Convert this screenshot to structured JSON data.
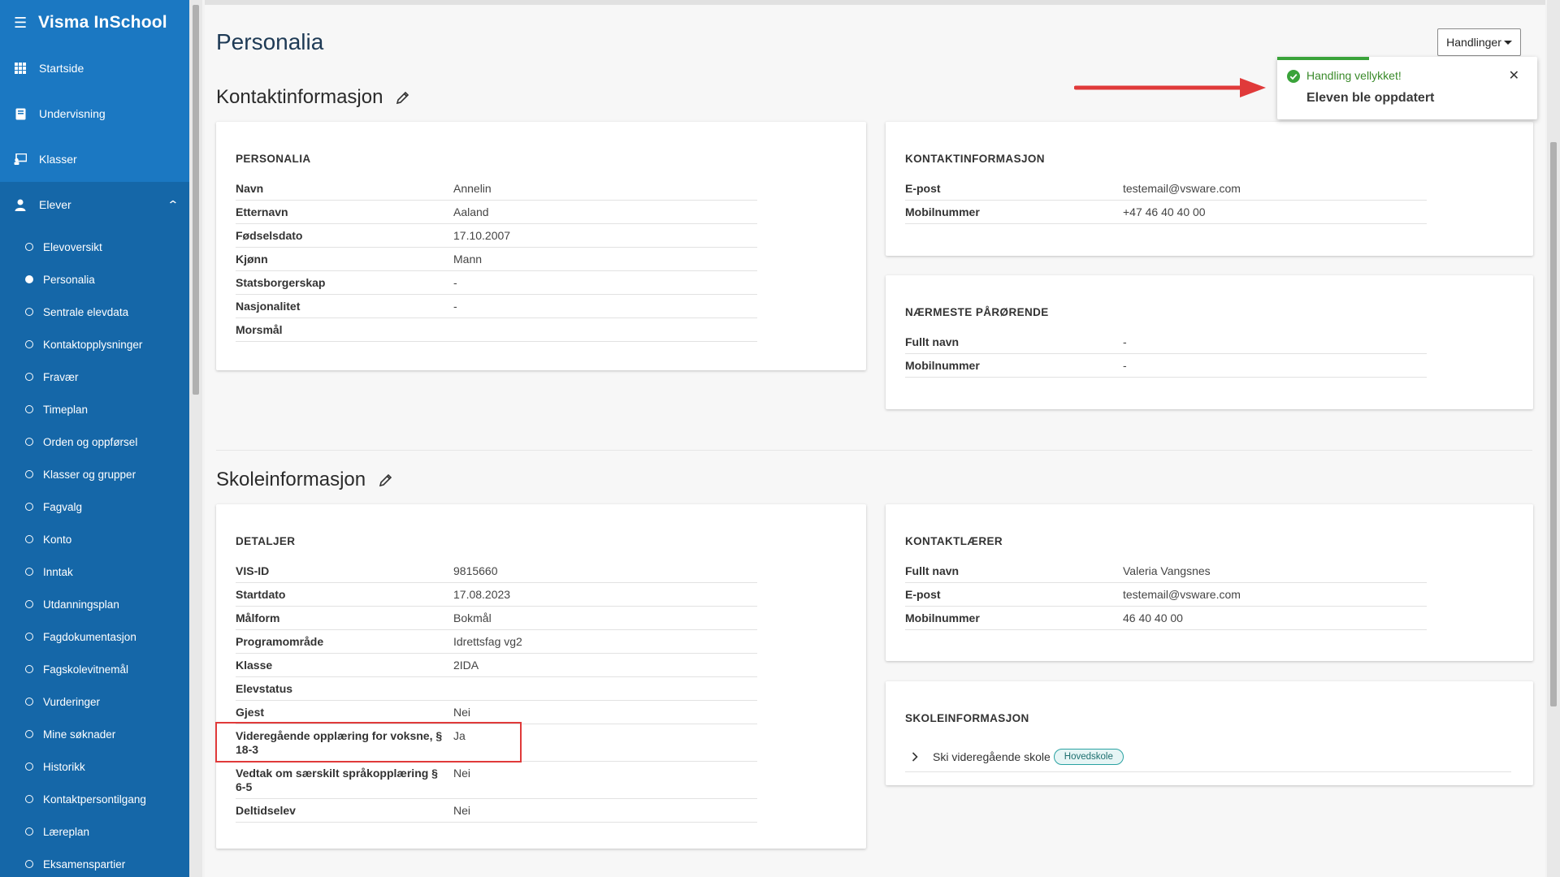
{
  "app": {
    "title": "Visma InSchool",
    "menu_icon": "hamburger-icon"
  },
  "nav": {
    "items": [
      {
        "label": "Startside",
        "icon": "grid-icon"
      },
      {
        "label": "Undervisning",
        "icon": "book-icon"
      },
      {
        "label": "Klasser",
        "icon": "classroom-icon"
      }
    ],
    "expanded": {
      "label": "Elever",
      "icon": "student-icon"
    },
    "subitems": [
      "Elevoversikt",
      "Personalia",
      "Sentrale elevdata",
      "Kontaktopplysninger",
      "Fravær",
      "Timeplan",
      "Orden og oppførsel",
      "Klasser og grupper",
      "Fagvalg",
      "Konto",
      "Inntak",
      "Utdanningsplan",
      "Fagdokumentasjon",
      "Fagskolevitnemål",
      "Vurderinger",
      "Mine søknader",
      "Historikk",
      "Kontaktpersontilgang",
      "Læreplan",
      "Eksamenspartier"
    ],
    "active_subitem": "Personalia"
  },
  "page": {
    "title": "Personalia",
    "actions_label": "Handlinger"
  },
  "contact_section": {
    "title": "Kontaktinformasjon",
    "personalia": {
      "heading": "PERSONALIA",
      "rows": [
        {
          "label": "Navn",
          "value": "Annelin"
        },
        {
          "label": "Etternavn",
          "value": "Aaland"
        },
        {
          "label": "Fødselsdato",
          "value": "17.10.2007"
        },
        {
          "label": "Kjønn",
          "value": "Mann"
        },
        {
          "label": "Statsborgerskap",
          "value": "-"
        },
        {
          "label": "Nasjonalitet",
          "value": "-"
        },
        {
          "label": "Morsmål",
          "value": ""
        }
      ]
    },
    "kontakt": {
      "heading": "KONTAKTINFORMASJON",
      "rows": [
        {
          "label": "E-post",
          "value": "testemail@vsware.com"
        },
        {
          "label": "Mobilnummer",
          "value": "+47 46 40 40 00"
        }
      ]
    },
    "parorende": {
      "heading": "NÆRMESTE PÅRØRENDE",
      "rows": [
        {
          "label": "Fullt navn",
          "value": "-"
        },
        {
          "label": "Mobilnummer",
          "value": "-"
        }
      ]
    }
  },
  "school_section": {
    "title": "Skoleinformasjon",
    "detaljer": {
      "heading": "DETALJER",
      "rows": [
        {
          "label": "VIS-ID",
          "value": "9815660"
        },
        {
          "label": "Startdato",
          "value": "17.08.2023"
        },
        {
          "label": "Målform",
          "value": "Bokmål"
        },
        {
          "label": "Programområde",
          "value": "Idrettsfag vg2"
        },
        {
          "label": "Klasse",
          "value": "2IDA"
        },
        {
          "label": "Elevstatus",
          "value": ""
        },
        {
          "label": "Gjest",
          "value": "Nei"
        },
        {
          "label": "Videregående opplæring for voksne, § 18-3",
          "value": "Ja"
        },
        {
          "label": "Vedtak om særskilt språkopplæring § 6-5",
          "value": "Nei"
        },
        {
          "label": "Deltidselev",
          "value": "Nei"
        }
      ]
    },
    "kontaktlaerer": {
      "heading": "KONTAKTLÆRER",
      "rows": [
        {
          "label": "Fullt navn",
          "value": "Valeria Vangsnes"
        },
        {
          "label": "E-post",
          "value": "testemail@vsware.com"
        },
        {
          "label": "Mobilnummer",
          "value": "46 40 40 00"
        }
      ]
    },
    "skoleinfo": {
      "heading": "SKOLEINFORMASJON",
      "school": "Ski videregående skole",
      "badge": "Hovedskole"
    }
  },
  "toast": {
    "title": "Handling vellykket!",
    "message": "Eleven ble oppdatert",
    "icon": "check-circle-icon",
    "close_icon": "close-icon",
    "accent": "#3aa33a"
  },
  "colors": {
    "sidebar": "#1b78c2",
    "sidebar_dark": "#1567a8",
    "highlight": "#e03a3a"
  }
}
